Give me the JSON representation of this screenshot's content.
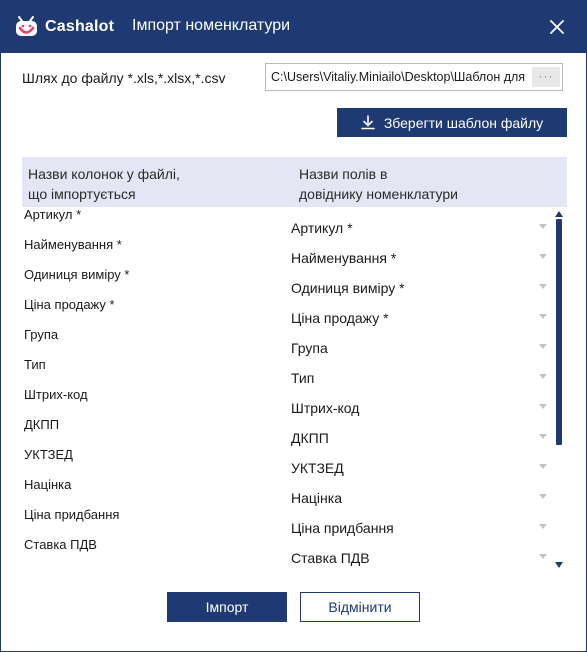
{
  "window": {
    "logo_text": "Cashalot",
    "title": "Імпорт номенклатури"
  },
  "file": {
    "label": "Шлях до файлу *.xls,*.xlsx,*.csv",
    "path_value": "C:\\Users\\Vitaliy.Miniailo\\Desktop\\Шаблон для ім",
    "browse_label": "···"
  },
  "save_template_label": "Зберегти шаблон файлу",
  "table": {
    "header_left": [
      "Назви колонок у файлі,",
      "що імпортується"
    ],
    "header_right": [
      "Назви полів в",
      "довіднику номенклатури"
    ]
  },
  "mappings": [
    {
      "source": "Артикул *",
      "target": "Артикул *"
    },
    {
      "source": "Найменування *",
      "target": "Найменування *"
    },
    {
      "source": "Одиниця виміру *",
      "target": "Одиниця виміру *"
    },
    {
      "source": "Ціна продажу *",
      "target": "Ціна продажу *"
    },
    {
      "source": "Група",
      "target": "Група"
    },
    {
      "source": "Тип",
      "target": "Тип"
    },
    {
      "source": "Штрих-код",
      "target": "Штрих-код"
    },
    {
      "source": "ДКПП",
      "target": "ДКПП"
    },
    {
      "source": "УКТЗЕД",
      "target": "УКТЗЕД"
    },
    {
      "source": "Націнка",
      "target": "Націнка"
    },
    {
      "source": "Ціна придбання",
      "target": "Ціна придбання"
    },
    {
      "source": "Ставка ПДВ",
      "target": "Ставка ПДВ"
    }
  ],
  "buttons": {
    "import": "Імпорт",
    "cancel": "Відмінити"
  },
  "colors": {
    "brand": "#1f3a73",
    "logo_accent": "#e83e6c",
    "header_bg": "#e4e6f3"
  },
  "icons": {
    "logo": "cashalot-logo-icon",
    "close": "close-icon",
    "save": "download-icon",
    "caret": "chevron-down-icon"
  }
}
